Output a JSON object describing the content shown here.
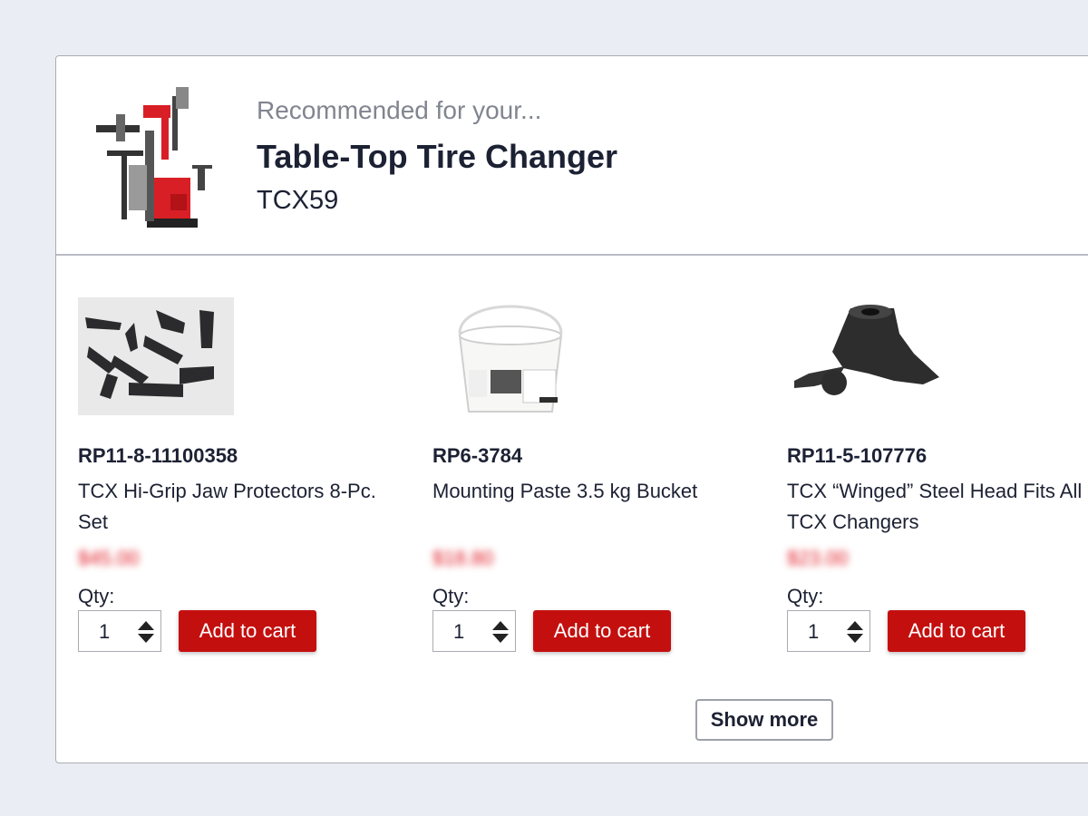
{
  "header": {
    "eyebrow": "Recommended for your...",
    "title": "Table-Top Tire Changer",
    "model": "TCX59",
    "image_icon": "tire-changer-machine"
  },
  "products": [
    {
      "sku": "RP11-8-11100358",
      "name": "TCX Hi-Grip Jaw Protectors 8-Pc. Set",
      "price": "$45.00",
      "qty_label": "Qty:",
      "qty": "1",
      "button": "Add to cart",
      "image_icon": "jaw-protectors"
    },
    {
      "sku": "RP6-3784",
      "name": "Mounting Paste 3.5 kg Bucket",
      "price": "$18.80",
      "qty_label": "Qty:",
      "qty": "1",
      "button": "Add to cart",
      "image_icon": "paste-bucket"
    },
    {
      "sku": "RP11-5-107776",
      "name": "TCX “Winged” Steel Head Fits All TCX Changers",
      "price": "$23.00",
      "qty_label": "Qty:",
      "qty": "1",
      "button": "Add to cart",
      "image_icon": "steel-mount-head"
    }
  ],
  "show_more": "Show more",
  "colors": {
    "background": "#eaedf4",
    "brand_red": "#c40f0f",
    "price_red": "#e0151f",
    "text_dark": "#1c2133",
    "text_muted": "#80858f"
  }
}
